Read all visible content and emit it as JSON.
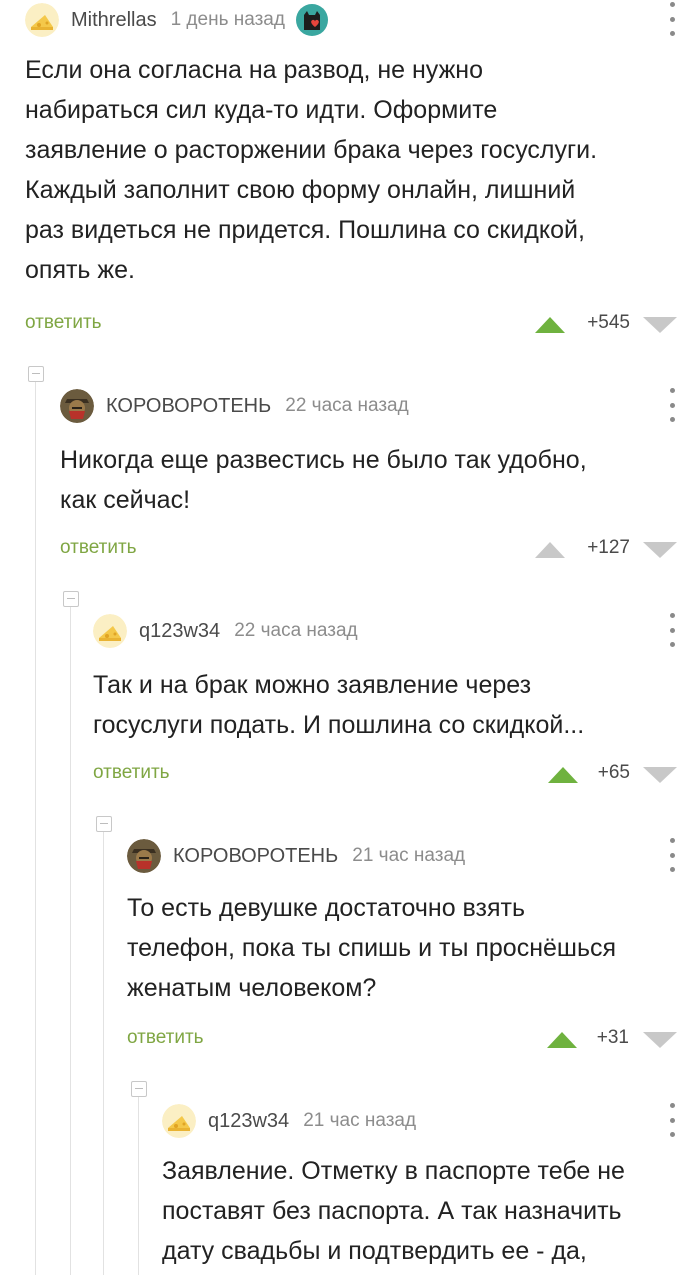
{
  "comments": [
    {
      "nick": "Mithrellas",
      "time": "1 день назад",
      "avatar": "cheese-avatar",
      "badge": "cat-heart-badge-icon",
      "text": "Если она согласна на развод, не нужно\nнабираться сил куда-то идти. Оформите\nзаявление о расторжении брака через госуслуги.\nКаждый заполнит свою форму онлайн, лишний\nраз видеться не придется. Пошлина со скидкой,\nопять же.",
      "reply": "ответить",
      "score": "+545",
      "up_color": "#6fb23f"
    },
    {
      "nick": "КОРОВОРОТЕНЬ",
      "time": "22 часа назад",
      "avatar": "knight-avatar",
      "text": "Никогда еще развестись не было так удобно,\nкак сейчас!",
      "reply": "ответить",
      "score": "+127",
      "up_color": "#c8c8c8"
    },
    {
      "nick": "q123w34",
      "time": "22 часа назад",
      "avatar": "cheese-avatar",
      "text": "Так и на брак можно заявление через\nгосуслуги подать. И пошлина со скидкой...",
      "reply": "ответить",
      "score": "+65",
      "up_color": "#6fb23f"
    },
    {
      "nick": "КОРОВОРОТЕНЬ",
      "time": "21 час назад",
      "avatar": "knight-avatar",
      "text": "То есть девушке достаточно взять\nтелефон, пока ты спишь и ты проснёшься\nженатым человеком?",
      "reply": "ответить",
      "score": "+31",
      "up_color": "#6fb23f"
    },
    {
      "nick": "q123w34",
      "time": "21 час назад",
      "avatar": "cheese-avatar",
      "text": "Заявление. Отметку в паспорте тебе не\nпоставят без паспорта. А так назначить\nдату свадьбы и подтвердить ее - да,"
    }
  ],
  "colors": {
    "link_green": "#7fa643",
    "vote_up_active": "#6fb23f",
    "vote_inactive": "#c8c8c8"
  }
}
